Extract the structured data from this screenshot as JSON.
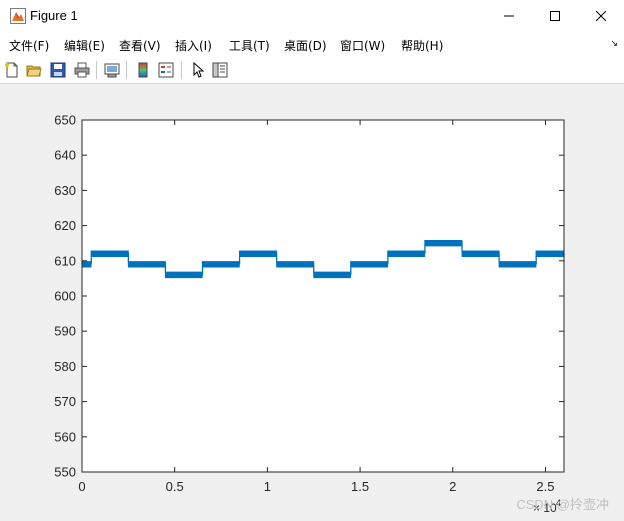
{
  "window": {
    "title": "Figure 1",
    "app_icon": "matlab-figure-icon",
    "controls": [
      "minimize-icon",
      "maximize-icon",
      "close-icon"
    ]
  },
  "menu": {
    "items": [
      {
        "label": "文件(F)"
      },
      {
        "label": "编辑(E)"
      },
      {
        "label": "查看(V)"
      },
      {
        "label": "插入(I)"
      },
      {
        "label": "工具(T)"
      },
      {
        "label": "桌面(D)"
      },
      {
        "label": "窗口(W)"
      },
      {
        "label": "帮助(H)"
      }
    ],
    "overflow_icon": "dock-arrow-icon"
  },
  "toolbar": {
    "icons": [
      "new-figure-icon",
      "open-file-icon",
      "save-icon",
      "print-icon",
      "link-plot-icon",
      "colorbar-icon",
      "legend-icon",
      "edit-plot-arrow-icon",
      "property-inspector-icon"
    ]
  },
  "watermark": "CSDN @拎壶冲",
  "chart_data": {
    "type": "line",
    "title": "",
    "xlabel": "",
    "ylabel": "",
    "x_exponent_label": "× 10",
    "x_exponent_value": "4",
    "xlim": [
      0,
      2.6
    ],
    "ylim": [
      550,
      650
    ],
    "xticks": [
      "0",
      "0.5",
      "1",
      "1.5",
      "2",
      "2.5"
    ],
    "yticks": [
      "550",
      "560",
      "570",
      "580",
      "590",
      "600",
      "610",
      "620",
      "630",
      "640",
      "650"
    ],
    "grid": false,
    "color": "#0072bd",
    "series": [
      {
        "x": [
          0,
          0.05,
          0.05,
          0.25,
          0.25,
          0.45,
          0.45,
          0.65,
          0.65,
          0.85,
          0.85,
          1.05,
          1.05,
          1.25,
          1.25,
          1.45,
          1.45,
          1.65,
          1.65,
          1.85,
          1.85,
          2.05,
          2.05,
          2.25,
          2.25,
          2.45,
          2.45,
          2.6
        ],
        "y": [
          609,
          609,
          612,
          612,
          609,
          609,
          606,
          606,
          609,
          609,
          612,
          612,
          609,
          609,
          606,
          606,
          609,
          609,
          612,
          612,
          615,
          615,
          612,
          612,
          609,
          609,
          612,
          612
        ]
      }
    ]
  }
}
